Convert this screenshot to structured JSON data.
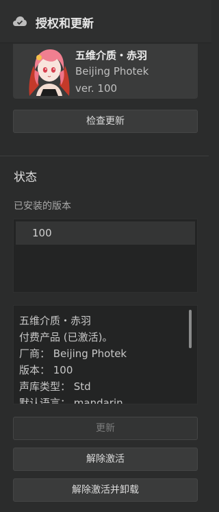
{
  "header": {
    "title": "授权和更新",
    "icon": "cloud-check-icon"
  },
  "product": {
    "name": "五维介质・赤羽",
    "vendor": "Beijing Photek",
    "version": "ver. 100"
  },
  "buttons": {
    "check_update": "检查更新",
    "update": "更新",
    "deactivate": "解除激活",
    "deactivate_uninstall": "解除激活并卸载"
  },
  "status": {
    "title": "状态",
    "installed_label": "已安装的版本",
    "installed_versions": [
      "100"
    ]
  },
  "info": {
    "lines": [
      "五维介质・赤羽",
      "付费产品 (已激活)。",
      "厂商： Beijing Photek",
      "版本： 100",
      "声库类型： Std",
      "默认语言： mandarin"
    ]
  },
  "colors": {
    "background": "#2b2c2c",
    "panel": "#3a3b3b",
    "box": "#232424"
  }
}
